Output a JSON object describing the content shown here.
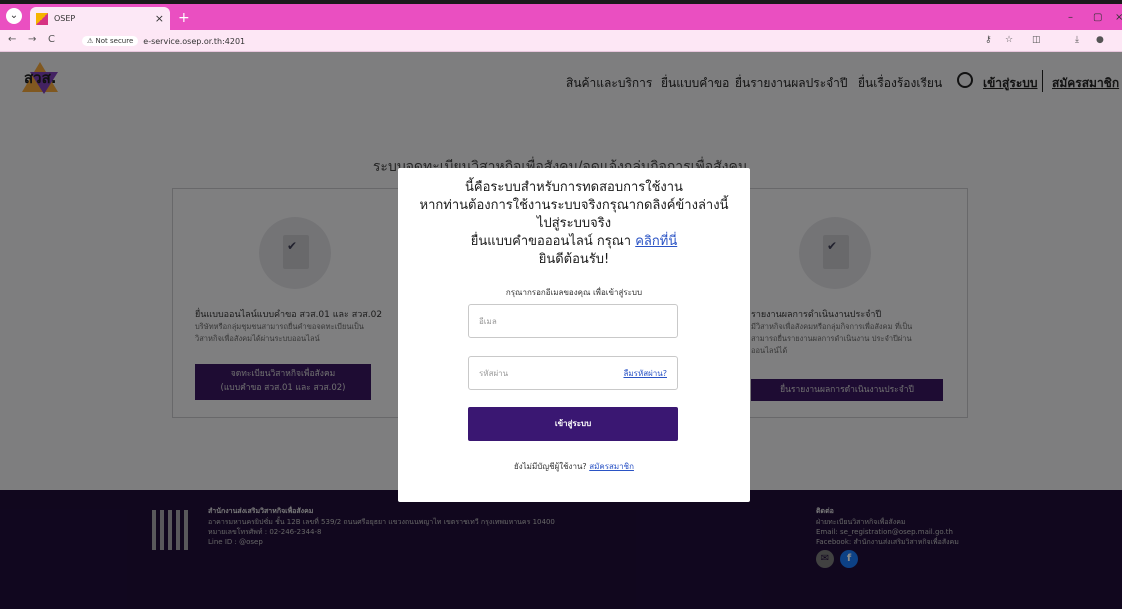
{
  "browser": {
    "tab_title": "OSEP",
    "tab_close": "×",
    "new_tab": "+",
    "secure_label": "Not secure",
    "url": "e-service.osep.or.th:4201",
    "back": "←",
    "forward": "→",
    "reload": "C"
  },
  "header": {
    "logo_text": "สวส.",
    "nav": [
      "สินค้าและบริการ",
      "ยื่นแบบคำขอ",
      "ยื่นรายงานผลประจำปี",
      "ยื่นเรื่องร้องเรียน"
    ],
    "login_link": "เข้าสู่ระบบ",
    "register_link": "สมัครสมาชิก"
  },
  "content": {
    "title": "ระบบจดทะเบียนวิสาหกิจเพื่อสังคม/จดแจ้งกลุ่มกิจการเพื่อสังคม",
    "left_card": {
      "heading": "ยื่นแบบออนไลน์แบบคำขอ สวส.01 และ สวส.02",
      "desc1": "บริษัทหรือกลุ่มชุมชนสามารถยื่นคำขอจดทะเบียนเป็น",
      "desc2": "วิสาหกิจเพื่อสังคมได้ผ่านระบบออนไลน์",
      "button_line1": "จดทะเบียนวิสาหกิจเพื่อสังคม",
      "button_line2": "(แบบคำขอ สวส.01 และ สวส.02)"
    },
    "right_card": {
      "heading": "รายงานผลการดำเนินงานประจำปี",
      "desc1": "มีวิสาหกิจเพื่อสังคมหรือกลุ่มกิจการเพื่อสังคม ที่เป็น",
      "desc2": "สามารถยื่นรายงานผลการดำเนินงาน ประจำปีผ่าน",
      "desc3": "ออนไลน์ได้",
      "button": "ยื่นรายงานผลการดำเนินงานประจำปี"
    }
  },
  "modal": {
    "line1": "นี้คือระบบสำหรับการทดสอบการใช้งาน",
    "line2": "หากท่านต้องการใช้งานระบบจริงกรุณากดลิงค์ข้างล่างนี้",
    "line3": "ไปสู่ระบบจริง",
    "line4_prefix": "ยื่นแบบคำขอออนไลน์ กรุณา ",
    "line4_link": "คลิกที่นี่",
    "line5": "ยินดีต้อนรับ!",
    "subtitle": "กรุณากรอกอีเมลของคุณ เพื่อเข้าสู่ระบบ",
    "email_placeholder": "อีเมล",
    "password_placeholder": "รหัสผ่าน",
    "forgot": "ลืมรหัสผ่าน?",
    "login_button": "เข้าสู่ระบบ",
    "no_account": "ยังไม่มีบัญชีผู้ใช้งาน?",
    "register": "สมัครสมาชิก"
  },
  "footer": {
    "org": "สำนักงานส่งเสริมวิสาหกิจเพื่อสังคม",
    "address": "อาคารมหานครยิปซั่ม ชั้น 12B เลขที่ 539/2 ถนนศรีอยุธยา แขวงถนนพญาไท เขตราชเทวี กรุงเทพมหานคร 10400",
    "phone": "หมายเลขโทรศัพท์ : 02-246-2344-8",
    "line": "Line ID : @osep",
    "contact_title": "ติดต่อ",
    "contact_dept": "ฝ่ายทะเบียนวิสาหกิจเพื่อสังคม",
    "contact_email": "Email: se_registration@osep.mail.go.th",
    "contact_fb": "Facebook: สำนักงานส่งเสริมวิสาหกิจเพื่อสังคม"
  }
}
